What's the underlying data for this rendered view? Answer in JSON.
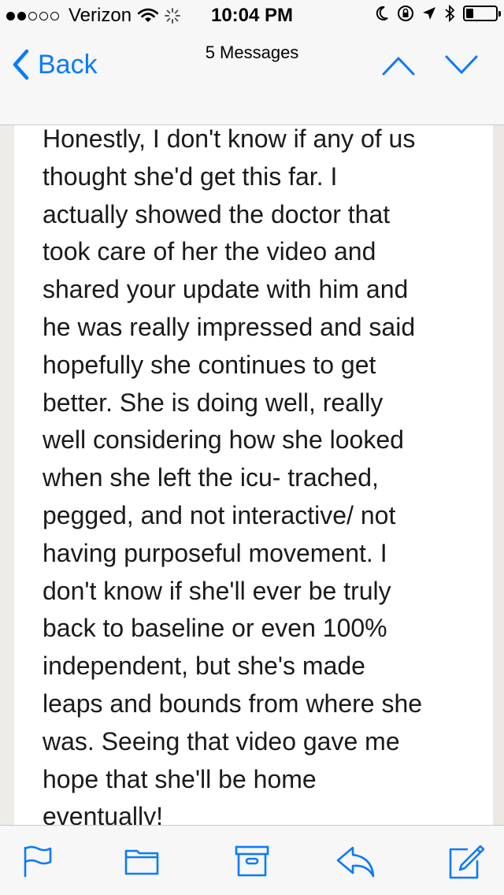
{
  "status_bar": {
    "signal_filled": 2,
    "signal_total": 5,
    "carrier": "Verizon",
    "time": "10:04 PM",
    "icons": [
      "wifi-icon",
      "activity-spinner-icon",
      "moon-icon",
      "rotation-lock-icon",
      "location-arrow-icon",
      "bluetooth-icon",
      "battery-icon"
    ],
    "battery_level": 0.25
  },
  "nav": {
    "back_label": "Back",
    "title": "5 Messages",
    "accent_color": "#0a7aff"
  },
  "message": {
    "body": "Honestly, I don't know if any of us\nthought she'd get this far. I\nactually showed the doctor that\ntook care of her the video and\nshared your update with him and\nhe was really impressed and said\nhopefully she continues to get\nbetter.  She is doing well, really\nwell considering how she looked\nwhen she  left the icu- trached,\npegged, and not interactive/ not\nhaving purposeful movement.  I\ndon't know if she'll ever be truly\nback to baseline or even 100%\nindependent, but she's made\nleaps and bounds from where she\nwas. Seeing that video gave me\nhope that she'll be home\neventually!"
  },
  "toolbar": {
    "items": [
      "flag-icon",
      "folder-icon",
      "archive-icon",
      "reply-icon",
      "compose-icon"
    ]
  }
}
